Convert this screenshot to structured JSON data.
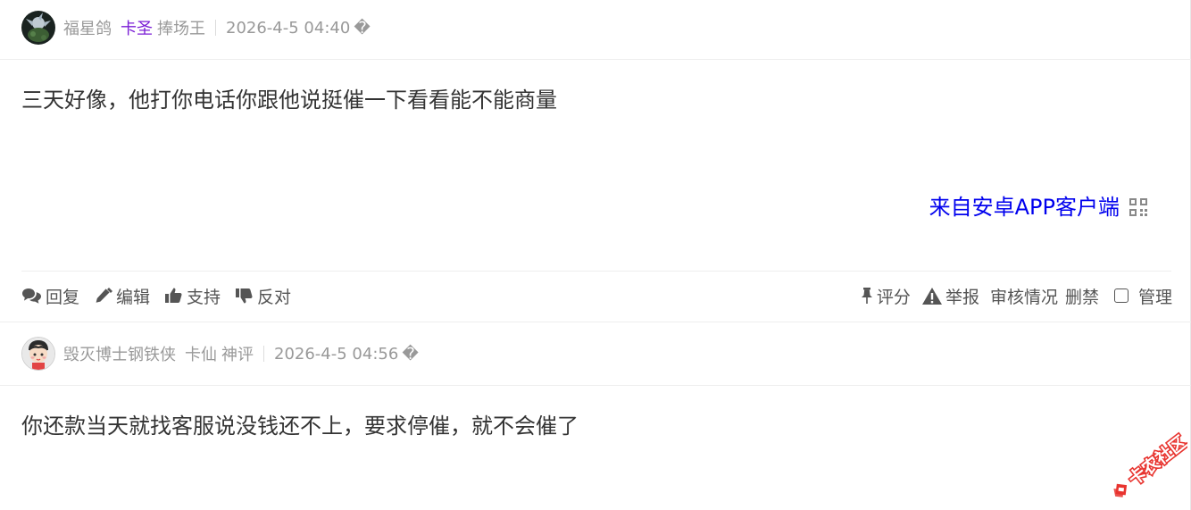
{
  "posts": [
    {
      "username": "福星鸽",
      "tags": [
        {
          "text": "卡圣",
          "color": "#7b1fd6"
        },
        {
          "text": "捧场王",
          "color": "#999999"
        }
      ],
      "time": "2026-4-5 04:40",
      "time_mark": "�",
      "content": "三天好像，他打你电话你跟他说挺催一下看看能不能商量",
      "source_link": "来自安卓APP客户端",
      "actions": {
        "reply": "回复",
        "edit": "编辑",
        "support": "支持",
        "oppose": "反对",
        "rate": "评分",
        "report": "举报",
        "review_status": "审核情况",
        "ban": "删禁",
        "manage": "管理"
      }
    },
    {
      "username": "毁灭博士钢铁侠",
      "tags": [
        {
          "text": "卡仙",
          "color": "#999999"
        },
        {
          "text": "神评",
          "color": "#999999"
        }
      ],
      "time": "2026-4-5 04:56",
      "time_mark": "�",
      "content": "你还款当天就找客服说没钱还不上，要求停催，就不会催了"
    }
  ],
  "watermark": "卡农社区",
  "colors": {
    "link": "#0000ee",
    "muted": "#999999",
    "tag_purple": "#7b1fd6",
    "icon": "#555555",
    "watermark_red": "#e8342f"
  },
  "icons": {
    "qr": "qr-code-icon",
    "reply": "comments-icon",
    "edit": "pencil-icon",
    "support": "thumbs-up-icon",
    "oppose": "thumbs-down-icon",
    "rate": "pin-icon",
    "report": "warning-icon"
  }
}
